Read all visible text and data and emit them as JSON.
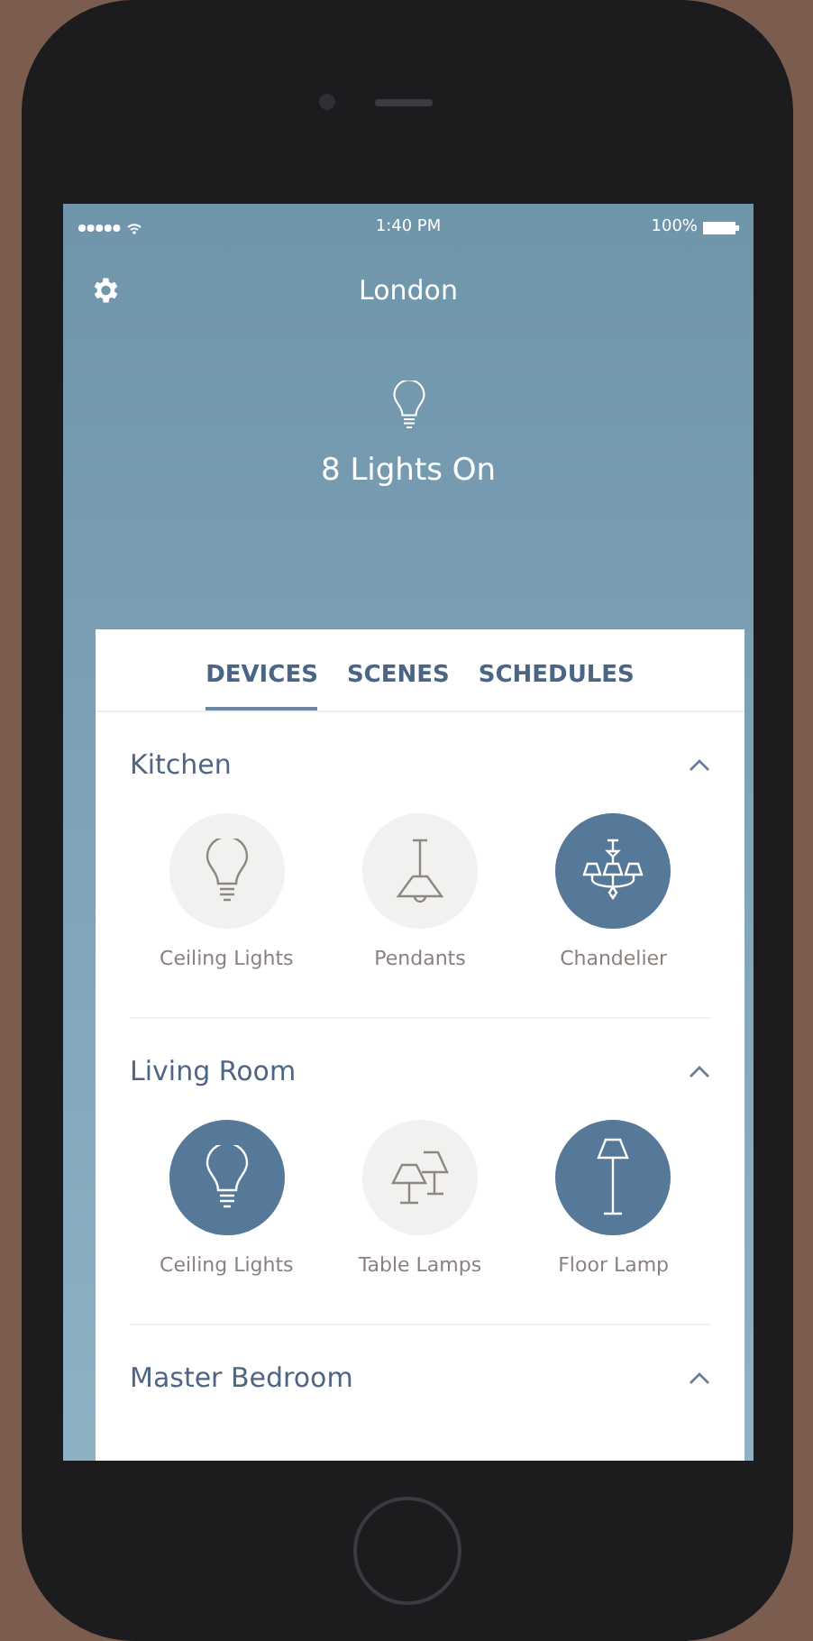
{
  "status_bar": {
    "time": "1:40 PM",
    "battery": "100%"
  },
  "header": {
    "title": "London"
  },
  "summary": {
    "text": "8 Lights On"
  },
  "tabs": [
    {
      "label": "DEVICES",
      "selected": true
    },
    {
      "label": "SCENES",
      "selected": false
    },
    {
      "label": "SCHEDULES",
      "selected": false
    }
  ],
  "rooms": [
    {
      "name": "Kitchen",
      "expanded": true,
      "devices": [
        {
          "name": "Ceiling Lights",
          "kind": "bulb",
          "on": false
        },
        {
          "name": "Pendants",
          "kind": "pendant",
          "on": false
        },
        {
          "name": "Chandelier",
          "kind": "chandelier",
          "on": true
        }
      ]
    },
    {
      "name": "Living Room",
      "expanded": true,
      "devices": [
        {
          "name": "Ceiling Lights",
          "kind": "bulb",
          "on": true
        },
        {
          "name": "Table Lamps",
          "kind": "tablelamps",
          "on": false
        },
        {
          "name": "Floor Lamp",
          "kind": "floorlamp",
          "on": true
        }
      ]
    },
    {
      "name": "Master Bedroom",
      "expanded": true
    }
  ]
}
